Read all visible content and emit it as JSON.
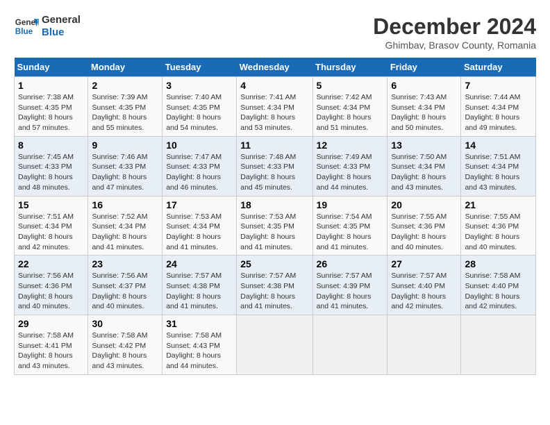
{
  "logo": {
    "line1": "General",
    "line2": "Blue"
  },
  "title": "December 2024",
  "subtitle": "Ghimbav, Brasov County, Romania",
  "days_of_week": [
    "Sunday",
    "Monday",
    "Tuesday",
    "Wednesday",
    "Thursday",
    "Friday",
    "Saturday"
  ],
  "weeks": [
    [
      {
        "day": "1",
        "info": "Sunrise: 7:38 AM\nSunset: 4:35 PM\nDaylight: 8 hours\nand 57 minutes."
      },
      {
        "day": "2",
        "info": "Sunrise: 7:39 AM\nSunset: 4:35 PM\nDaylight: 8 hours\nand 55 minutes."
      },
      {
        "day": "3",
        "info": "Sunrise: 7:40 AM\nSunset: 4:35 PM\nDaylight: 8 hours\nand 54 minutes."
      },
      {
        "day": "4",
        "info": "Sunrise: 7:41 AM\nSunset: 4:34 PM\nDaylight: 8 hours\nand 53 minutes."
      },
      {
        "day": "5",
        "info": "Sunrise: 7:42 AM\nSunset: 4:34 PM\nDaylight: 8 hours\nand 51 minutes."
      },
      {
        "day": "6",
        "info": "Sunrise: 7:43 AM\nSunset: 4:34 PM\nDaylight: 8 hours\nand 50 minutes."
      },
      {
        "day": "7",
        "info": "Sunrise: 7:44 AM\nSunset: 4:34 PM\nDaylight: 8 hours\nand 49 minutes."
      }
    ],
    [
      {
        "day": "8",
        "info": "Sunrise: 7:45 AM\nSunset: 4:33 PM\nDaylight: 8 hours\nand 48 minutes."
      },
      {
        "day": "9",
        "info": "Sunrise: 7:46 AM\nSunset: 4:33 PM\nDaylight: 8 hours\nand 47 minutes."
      },
      {
        "day": "10",
        "info": "Sunrise: 7:47 AM\nSunset: 4:33 PM\nDaylight: 8 hours\nand 46 minutes."
      },
      {
        "day": "11",
        "info": "Sunrise: 7:48 AM\nSunset: 4:33 PM\nDaylight: 8 hours\nand 45 minutes."
      },
      {
        "day": "12",
        "info": "Sunrise: 7:49 AM\nSunset: 4:33 PM\nDaylight: 8 hours\nand 44 minutes."
      },
      {
        "day": "13",
        "info": "Sunrise: 7:50 AM\nSunset: 4:34 PM\nDaylight: 8 hours\nand 43 minutes."
      },
      {
        "day": "14",
        "info": "Sunrise: 7:51 AM\nSunset: 4:34 PM\nDaylight: 8 hours\nand 43 minutes."
      }
    ],
    [
      {
        "day": "15",
        "info": "Sunrise: 7:51 AM\nSunset: 4:34 PM\nDaylight: 8 hours\nand 42 minutes."
      },
      {
        "day": "16",
        "info": "Sunrise: 7:52 AM\nSunset: 4:34 PM\nDaylight: 8 hours\nand 41 minutes."
      },
      {
        "day": "17",
        "info": "Sunrise: 7:53 AM\nSunset: 4:34 PM\nDaylight: 8 hours\nand 41 minutes."
      },
      {
        "day": "18",
        "info": "Sunrise: 7:53 AM\nSunset: 4:35 PM\nDaylight: 8 hours\nand 41 minutes."
      },
      {
        "day": "19",
        "info": "Sunrise: 7:54 AM\nSunset: 4:35 PM\nDaylight: 8 hours\nand 41 minutes."
      },
      {
        "day": "20",
        "info": "Sunrise: 7:55 AM\nSunset: 4:36 PM\nDaylight: 8 hours\nand 40 minutes."
      },
      {
        "day": "21",
        "info": "Sunrise: 7:55 AM\nSunset: 4:36 PM\nDaylight: 8 hours\nand 40 minutes."
      }
    ],
    [
      {
        "day": "22",
        "info": "Sunrise: 7:56 AM\nSunset: 4:36 PM\nDaylight: 8 hours\nand 40 minutes."
      },
      {
        "day": "23",
        "info": "Sunrise: 7:56 AM\nSunset: 4:37 PM\nDaylight: 8 hours\nand 40 minutes."
      },
      {
        "day": "24",
        "info": "Sunrise: 7:57 AM\nSunset: 4:38 PM\nDaylight: 8 hours\nand 41 minutes."
      },
      {
        "day": "25",
        "info": "Sunrise: 7:57 AM\nSunset: 4:38 PM\nDaylight: 8 hours\nand 41 minutes."
      },
      {
        "day": "26",
        "info": "Sunrise: 7:57 AM\nSunset: 4:39 PM\nDaylight: 8 hours\nand 41 minutes."
      },
      {
        "day": "27",
        "info": "Sunrise: 7:57 AM\nSunset: 4:40 PM\nDaylight: 8 hours\nand 42 minutes."
      },
      {
        "day": "28",
        "info": "Sunrise: 7:58 AM\nSunset: 4:40 PM\nDaylight: 8 hours\nand 42 minutes."
      }
    ],
    [
      {
        "day": "29",
        "info": "Sunrise: 7:58 AM\nSunset: 4:41 PM\nDaylight: 8 hours\nand 43 minutes."
      },
      {
        "day": "30",
        "info": "Sunrise: 7:58 AM\nSunset: 4:42 PM\nDaylight: 8 hours\nand 43 minutes."
      },
      {
        "day": "31",
        "info": "Sunrise: 7:58 AM\nSunset: 4:43 PM\nDaylight: 8 hours\nand 44 minutes."
      },
      {
        "day": "",
        "info": ""
      },
      {
        "day": "",
        "info": ""
      },
      {
        "day": "",
        "info": ""
      },
      {
        "day": "",
        "info": ""
      }
    ]
  ]
}
